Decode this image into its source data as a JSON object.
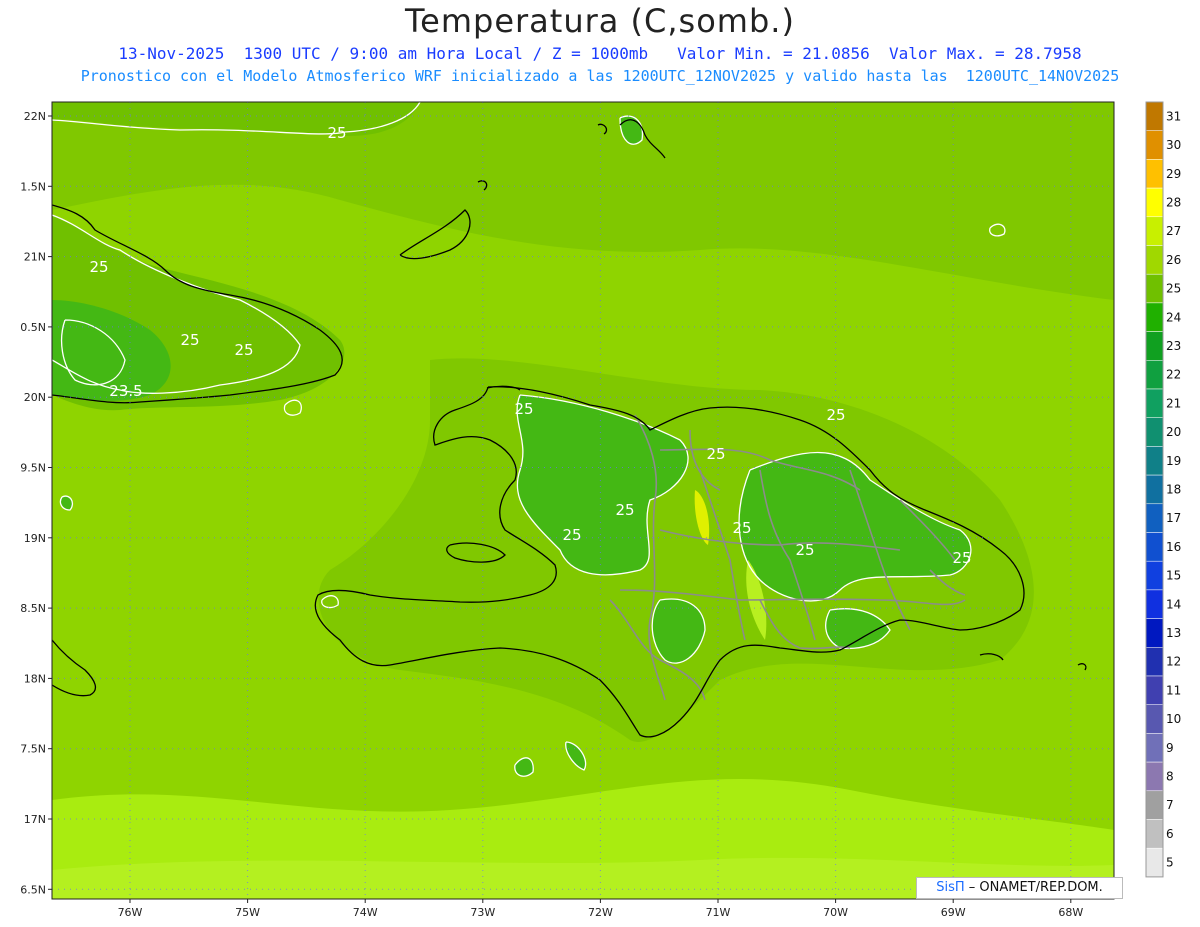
{
  "header": {
    "title": "Temperatura (C,somb.)",
    "subtitle_line1": "13-Nov-2025  1300 UTC / 9:00 am Hora Local / Z = 1000mb   Valor Min. = 21.0856  Valor Max. = 28.7958",
    "subtitle_line2": "Pronostico con el Modelo Atmosferico WRF inicializado a las 1200UTC_12NOV2025 y valido hasta las  1200UTC_14NOV2025"
  },
  "map": {
    "lat_labels": [
      "22N",
      "1.5N",
      "21N",
      "0.5N",
      "20N",
      "9.5N",
      "19N",
      "8.5N",
      "18N",
      "7.5N",
      "17N",
      "6.5N"
    ],
    "lon_labels": [
      "76W",
      "75W",
      "74W",
      "73W",
      "72W",
      "71W",
      "70W",
      "69W",
      "68W"
    ],
    "contour_labels": [
      "25",
      "25",
      "25",
      "25",
      "23.5",
      "25",
      "25",
      "25",
      "25",
      "25",
      "25",
      "25",
      "25"
    ],
    "colors": {
      "dominant_fill": "#8fd400",
      "warm_fill": "#a9ec10",
      "cool_fill": "#44b814",
      "coast": "#000000",
      "provinces": "#909090",
      "contour": "#ffffff"
    }
  },
  "colorbar": {
    "levels": [
      "31",
      "30",
      "29",
      "28",
      "27",
      "26",
      "25",
      "24",
      "23",
      "22",
      "21",
      "20",
      "19",
      "18",
      "17",
      "16",
      "15",
      "14",
      "13",
      "12",
      "11",
      "10",
      "9",
      "8",
      "7",
      "6",
      "5"
    ],
    "colors": [
      "#c07800",
      "#e09000",
      "#ffc000",
      "#ffff00",
      "#c8f000",
      "#a0d800",
      "#70c000",
      "#20b000",
      "#10a020",
      "#10a040",
      "#10a060",
      "#109070",
      "#108088",
      "#1070a0",
      "#1060c0",
      "#1050d0",
      "#1040e0",
      "#1030e0",
      "#0018c0",
      "#2030b0",
      "#4040b0",
      "#5858b0",
      "#7070b8",
      "#8c78b0",
      "#a0a0a0",
      "#c0c0c0",
      "#e8e8e8"
    ]
  },
  "credit": {
    "brand": "SisΠ",
    "text": "– ONAMET/REP.DOM."
  }
}
